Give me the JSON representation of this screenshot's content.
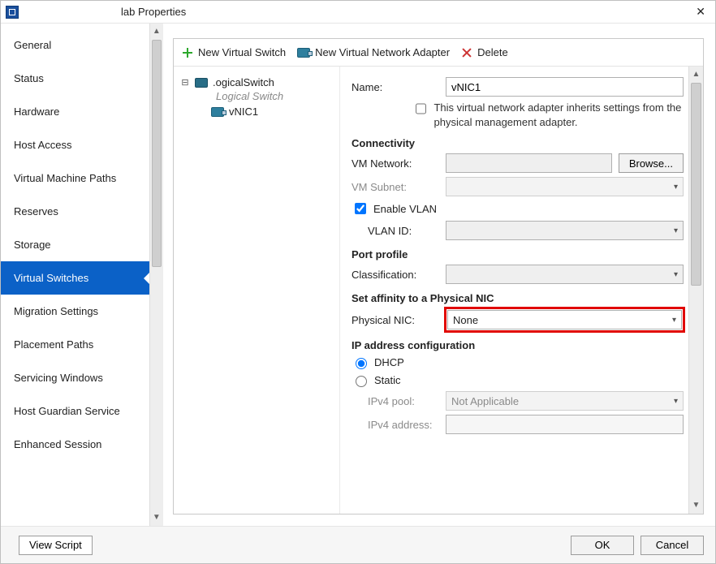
{
  "window": {
    "title": "lab Properties"
  },
  "sidebar": {
    "items": [
      {
        "label": "General"
      },
      {
        "label": "Status"
      },
      {
        "label": "Hardware"
      },
      {
        "label": "Host Access"
      },
      {
        "label": "Virtual Machine Paths"
      },
      {
        "label": "Reserves"
      },
      {
        "label": "Storage"
      },
      {
        "label": "Virtual Switches",
        "selected": true
      },
      {
        "label": "Migration Settings"
      },
      {
        "label": "Placement Paths"
      },
      {
        "label": "Servicing Windows"
      },
      {
        "label": "Host Guardian Service"
      },
      {
        "label": "Enhanced Session"
      }
    ]
  },
  "toolbar": {
    "new_switch": "New Virtual Switch",
    "new_adapter": "New Virtual Network Adapter",
    "delete": "Delete"
  },
  "tree": {
    "root_label": ".ogicalSwitch",
    "root_subtitle": "Logical Switch",
    "child_label": "vNIC1"
  },
  "form": {
    "name_label": "Name:",
    "name_value": "vNIC1",
    "inherit_text": "This virtual network adapter inherits settings from the physical management adapter.",
    "connectivity_head": "Connectivity",
    "vmnet_label": "VM Network:",
    "vmnet_value": "",
    "browse_label": "Browse...",
    "vmsubnet_label": "VM Subnet:",
    "vmsubnet_value": "",
    "enable_vlan_label": "Enable VLAN",
    "vlan_id_label": "VLAN ID:",
    "vlan_id_value": "",
    "portprofile_head": "Port profile",
    "classification_label": "Classification:",
    "classification_value": "",
    "affinity_head": "Set affinity to a Physical NIC",
    "physnic_label": "Physical NIC:",
    "physnic_value": "None",
    "ipconfig_head": "IP address configuration",
    "dhcp_label": "DHCP",
    "static_label": "Static",
    "ipv4pool_label": "IPv4 pool:",
    "ipv4pool_value": "Not Applicable",
    "ipv4addr_label": "IPv4 address:",
    "ipv4addr_value": ""
  },
  "footer": {
    "view_script": "View Script",
    "ok": "OK",
    "cancel": "Cancel"
  }
}
